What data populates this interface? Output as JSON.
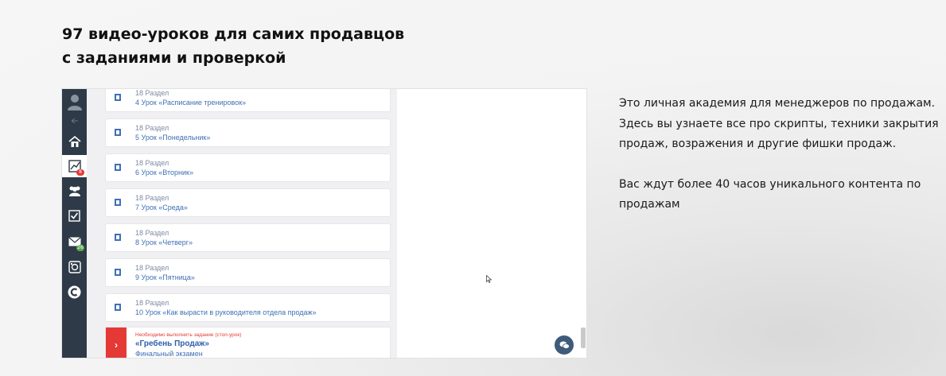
{
  "heading": {
    "line1": "97 видео-уроков для самих продавцов",
    "line2": "с заданиями и проверкой"
  },
  "screenshot": {
    "sidebar": {
      "items": [
        {
          "icon": "user-avatar-icon"
        },
        {
          "icon": "arrow-left-icon"
        },
        {
          "icon": "home-icon"
        },
        {
          "icon": "chart-icon",
          "badge": "8",
          "badge_color": "#e53935"
        },
        {
          "icon": "team-icon"
        },
        {
          "icon": "checkbox-icon"
        },
        {
          "icon": "mail-icon",
          "badge": "26",
          "badge_color": "#5aa64a"
        },
        {
          "icon": "support-icon"
        },
        {
          "icon": "c-logo-icon"
        }
      ]
    },
    "lessons": [
      {
        "section": "18 Раздел",
        "lesson": "4 Урок «Расписание тренировок»"
      },
      {
        "section": "18 Раздел",
        "lesson": "5 Урок «Понедельник»"
      },
      {
        "section": "18 Раздел",
        "lesson": "6 Урок «Вторник»"
      },
      {
        "section": "18 Раздел",
        "lesson": "7 Урок «Среда»"
      },
      {
        "section": "18 Раздел",
        "lesson": "8 Урок «Четверг»"
      },
      {
        "section": "18 Раздел",
        "lesson": "9 Урок «Пятница»"
      },
      {
        "section": "18 Раздел",
        "lesson": "10 Урок «Как вырасти в руководителя отдела продаж»"
      }
    ],
    "final_lesson": {
      "warning": "Необходимо выполнить задание (стоп-урок)",
      "title": "«Гребень Продаж»",
      "subtitle": "Финальный экзамен",
      "arrow": "›"
    },
    "chat_icon": "chat-bubble-icon"
  },
  "description": {
    "paragraph1": "Это личная академия для менеджеров по продажам. Здесь вы узнаете все про скрипты, техники закрытия продаж, возражения и другие фишки продаж.",
    "paragraph2": "Вас ждут более 40 часов уникального контента по продажам"
  },
  "colors": {
    "sidebar_bg": "#2e3a47",
    "accent_red": "#e53935",
    "link_blue": "#3f6fb5",
    "chat_button": "#3e5b7b"
  }
}
